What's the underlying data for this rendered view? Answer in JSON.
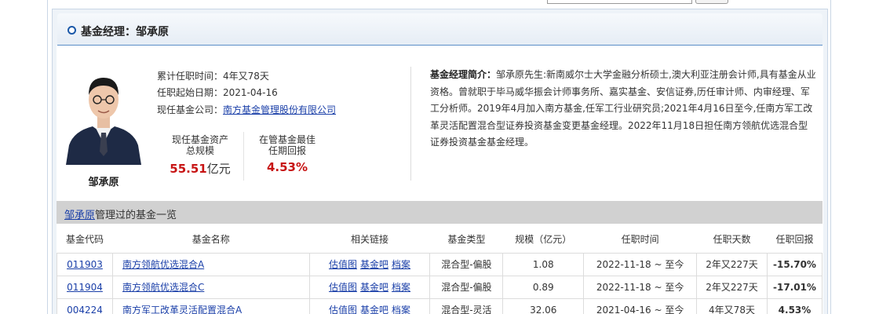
{
  "header": {
    "title": "基金经理：邹承原"
  },
  "manager": {
    "name": "邹承原",
    "tenure_label": "累计任职时间：",
    "tenure_value": "4年又78天",
    "start_label": "任职起始日期：",
    "start_value": "2021-04-16",
    "company_label": "现任基金公司：",
    "company_value": "南方基金管理股份有限公司"
  },
  "stats": {
    "assets_label_1": "现任基金资产",
    "assets_label_2": "总规模",
    "assets_value": "55.51",
    "assets_unit": "亿元",
    "return_label_1": "在管基金最佳",
    "return_label_2": "任期回报",
    "return_value": "4.53%"
  },
  "bio": {
    "label": "基金经理简介：",
    "text": "邹承原先生:新南威尔士大学金融分析硕士,澳大利亚注册会计师,具有基金从业资格。曾就职于毕马威华振会计师事务所、嘉实基金、安信证券,历任审计师、内审经理、军工分析师。2019年4月加入南方基金,任军工行业研究员;2021年4月16日至今,任南方军工改革灵活配置混合型证券投资基金变更基金经理。2022年11月18日担任南方领航优选混合型证券投资基金基金经理。"
  },
  "fund_list": {
    "title_link": "邹承原",
    "title_suffix": "管理过的基金一览",
    "columns": [
      "基金代码",
      "基金名称",
      "相关链接",
      "基金类型",
      "规模（亿元）",
      "任职时间",
      "任职天数",
      "任职回报"
    ],
    "link_labels": [
      "估值图",
      "基金吧",
      "档案"
    ],
    "rows": [
      {
        "code": "011903",
        "name": "南方领航优选混合A",
        "type": "混合型-偏股",
        "scale": "1.08",
        "period": "2022-11-18 ~ 至今",
        "days": "2年又227天",
        "return": "-15.70%",
        "return_sign": "neg"
      },
      {
        "code": "011904",
        "name": "南方领航优选混合C",
        "type": "混合型-偏股",
        "scale": "0.89",
        "period": "2022-11-18 ~ 至今",
        "days": "2年又227天",
        "return": "-17.01%",
        "return_sign": "neg"
      },
      {
        "code": "004224",
        "name": "南方军工改革灵活配置混合A",
        "type": "混合型-灵活",
        "scale": "32.06",
        "period": "2021-04-16 ~ 至今",
        "days": "4年又78天",
        "return": "4.53%",
        "return_sign": "pos"
      }
    ]
  },
  "colors": {
    "accent": "#1a58a8",
    "link": "#1a3fa8",
    "negative": "#138a18",
    "positive": "#c71414"
  }
}
